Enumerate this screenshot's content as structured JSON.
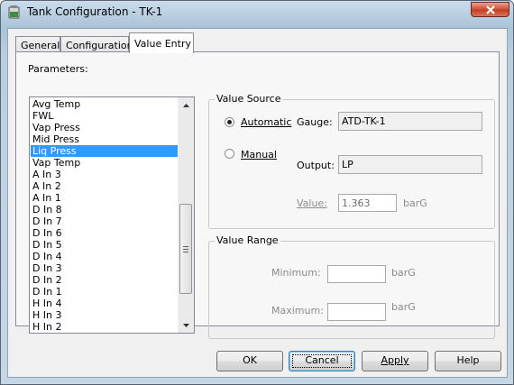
{
  "window": {
    "title": "Tank Configuration - TK-1"
  },
  "tabs": [
    {
      "label": "General"
    },
    {
      "label": "Configuration"
    },
    {
      "label": "Value Entry"
    }
  ],
  "parameters": {
    "label": "Parameters:",
    "selected": "Liq Press",
    "items": [
      "Avg Temp",
      "FWL",
      "Vap Press",
      "Mid Press",
      "Liq Press",
      "Vap Temp",
      "A In 3",
      "A In 2",
      "A In 1",
      "D In 8",
      "D In 7",
      "D In 6",
      "D In 5",
      "D In 4",
      "D In 3",
      "D In 2",
      "D In 1",
      "H In 4",
      "H In 3",
      "H In 2"
    ]
  },
  "value_source": {
    "title": "Value Source",
    "automatic_label": "Automatic",
    "manual_label": "Manual",
    "selected": "Automatic",
    "gauge_label": "Gauge:",
    "gauge_value": "ATD-TK-1",
    "output_label": "Output:",
    "output_value": "LP",
    "value_label": "Value:",
    "value": "1.363",
    "value_unit": "barG"
  },
  "value_range": {
    "title": "Value Range",
    "minimum_label": "Minimum:",
    "minimum_value": "",
    "minimum_unit": "barG",
    "maximum_label": "Maximum:",
    "maximum_value": "",
    "maximum_unit": "barG"
  },
  "buttons": {
    "ok": "OK",
    "cancel": "Cancel",
    "apply": "Apply",
    "help": "Help"
  },
  "icons": {
    "app": "tank-icon",
    "close": "close-icon",
    "scroll_up": "arrow-up-icon",
    "scroll_down": "arrow-down-icon",
    "grip": "scroll-grip-icon"
  },
  "colors": {
    "selection": "#3399ff",
    "close_button": "#c94a30",
    "frame": "#b9cfe0"
  }
}
